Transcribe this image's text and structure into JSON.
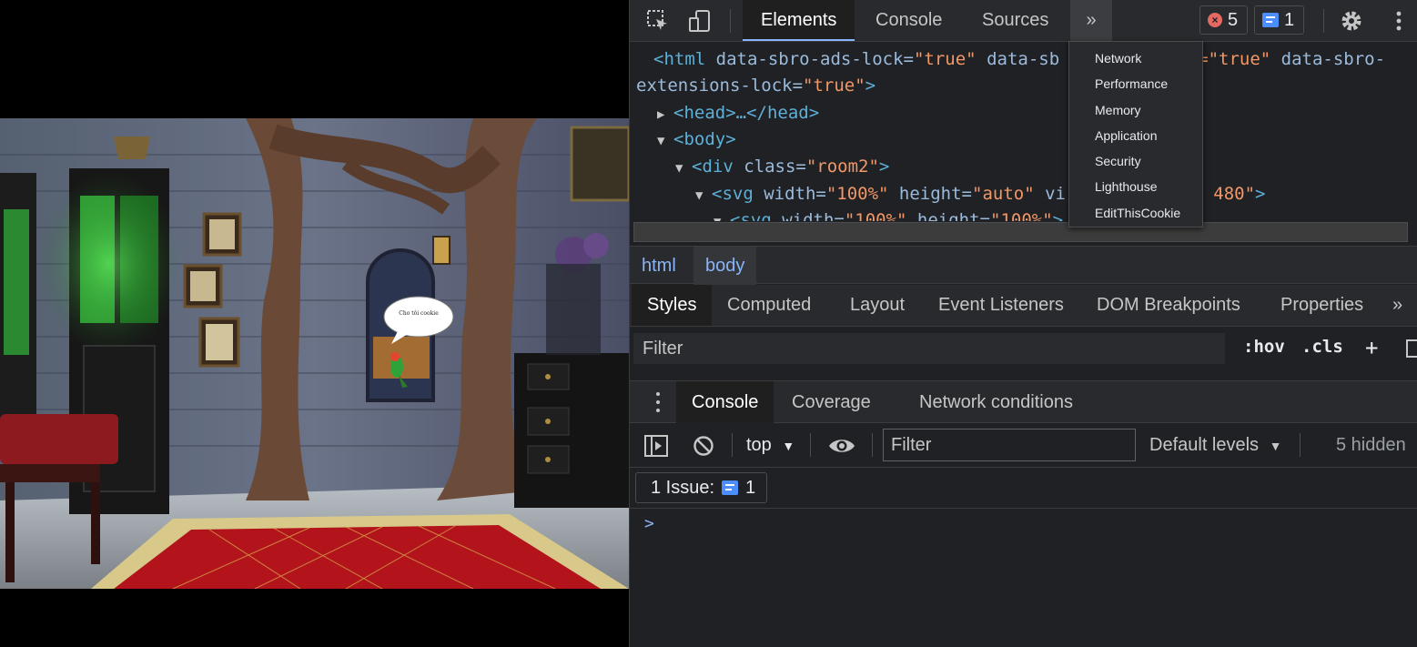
{
  "scene": {
    "bubble_text": "Cho tôi cookie"
  },
  "devtools": {
    "main_tabs": [
      {
        "label": "Elements",
        "active": true
      },
      {
        "label": "Console",
        "active": false
      },
      {
        "label": "Sources",
        "active": false
      }
    ],
    "more_tabs_glyph": "»",
    "error_count": "5",
    "message_count": "1",
    "error_icon": "error-x-icon",
    "message_icon": "message-icon",
    "overflow_menu": [
      "Network",
      "Performance",
      "Memory",
      "Application",
      "Security",
      "Lighthouse",
      "EditThisCookie"
    ],
    "dom_tree": {
      "line1": {
        "tag_open": "<html",
        "attr1": " data-sbro-ads-lock=",
        "val1": "\"true\"",
        "attr2": " data-sb",
        "val2": "=\"true\"",
        "attr3": " data-sbro-"
      },
      "line2": {
        "attr": "extensions-lock=",
        "val": "\"true\"",
        "tag_close": ">"
      },
      "line3": {
        "text": "<head>…</head>"
      },
      "line4": {
        "text": "<body>"
      },
      "line5": {
        "tag_open": "<div",
        "attr": " class=",
        "val": "\"room2\"",
        "tag_close": ">"
      },
      "line6": {
        "tag_open": "<svg",
        "attr1": " width=",
        "val1": "\"100%\"",
        "attr2": " height=",
        "val2": "\"auto\"",
        "attr3": " vi",
        "val3": "40 480\"",
        "tag_close": ">"
      },
      "line7": {
        "tag_open": "<svg",
        "attr1": " width=",
        "val1": "\"100%\"",
        "attr2": " height=",
        "val2": "\"100%\"",
        "tag_close": ">"
      }
    },
    "breadcrumb": [
      "html",
      "body"
    ],
    "styles_tabs": [
      {
        "label": "Styles",
        "active": true
      },
      {
        "label": "Computed",
        "active": false
      },
      {
        "label": "Layout",
        "active": false
      },
      {
        "label": "Event Listeners",
        "active": false
      },
      {
        "label": "DOM Breakpoints",
        "active": false
      },
      {
        "label": "Properties",
        "active": false
      }
    ],
    "styles_filter_placeholder": "Filter",
    "hov_label": ":hov",
    "cls_label": ".cls",
    "plus_label": "+",
    "drawer_tabs": [
      {
        "label": "Console",
        "active": true
      },
      {
        "label": "Coverage",
        "active": false
      },
      {
        "label": "Network conditions",
        "active": false
      }
    ],
    "console": {
      "context": "top",
      "filter_placeholder": "Filter",
      "levels_label": "Default levels",
      "hidden_label": "5 hidden",
      "issues_label": "1 Issue:",
      "issues_count": "1",
      "prompt": ">"
    }
  },
  "colors": {
    "accent": "#8ab4f8",
    "error": "#e46962",
    "message": "#4d8eff",
    "panel_bg": "#202124",
    "toolbar_bg": "#292a2d"
  }
}
